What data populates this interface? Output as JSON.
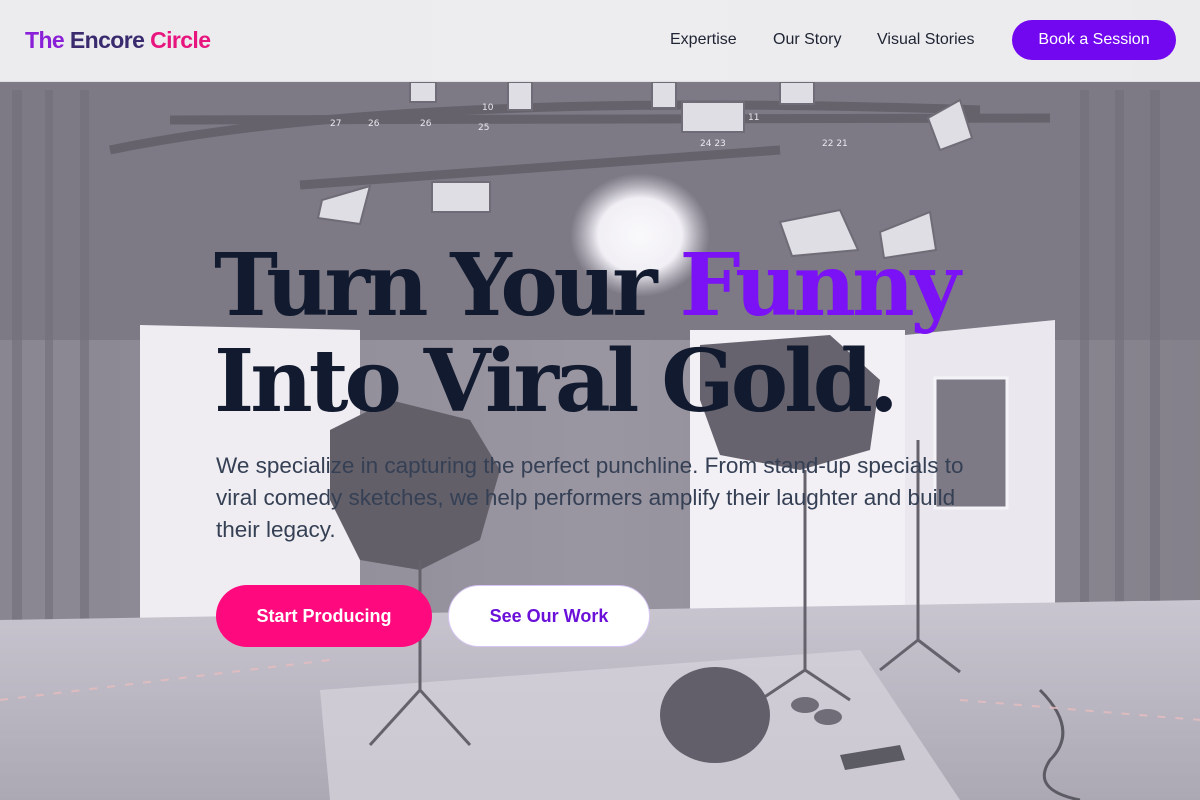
{
  "header": {
    "logo": {
      "word1": "The",
      "word2": "Encore",
      "word3": "Circle"
    },
    "nav": [
      "Expertise",
      "Our Story",
      "Visual Stories"
    ],
    "cta_label": "Book a Session"
  },
  "hero": {
    "headline": {
      "line1_start": "Turn Your ",
      "line1_accent": "Funny",
      "line2": "Into Viral Gold."
    },
    "subtext": "We specialize in capturing the perfect punchline. From stand-up specials to viral comedy sketches, we help performers amplify their laughter and build their legacy.",
    "primary_button": "Start Producing",
    "secondary_button": "See Our Work",
    "background_image": "photo-studio-with-lighting-equipment"
  },
  "colors": {
    "brand_purple": "#7208f0",
    "accent_purple": "#7a12f5",
    "accent_pink": "#ff0a7e",
    "headline_navy": "#111a2e",
    "logo_purple": "#8a1fd8",
    "logo_pink": "#e8157f"
  },
  "icons": [
    "studio-lights-illustration"
  ]
}
